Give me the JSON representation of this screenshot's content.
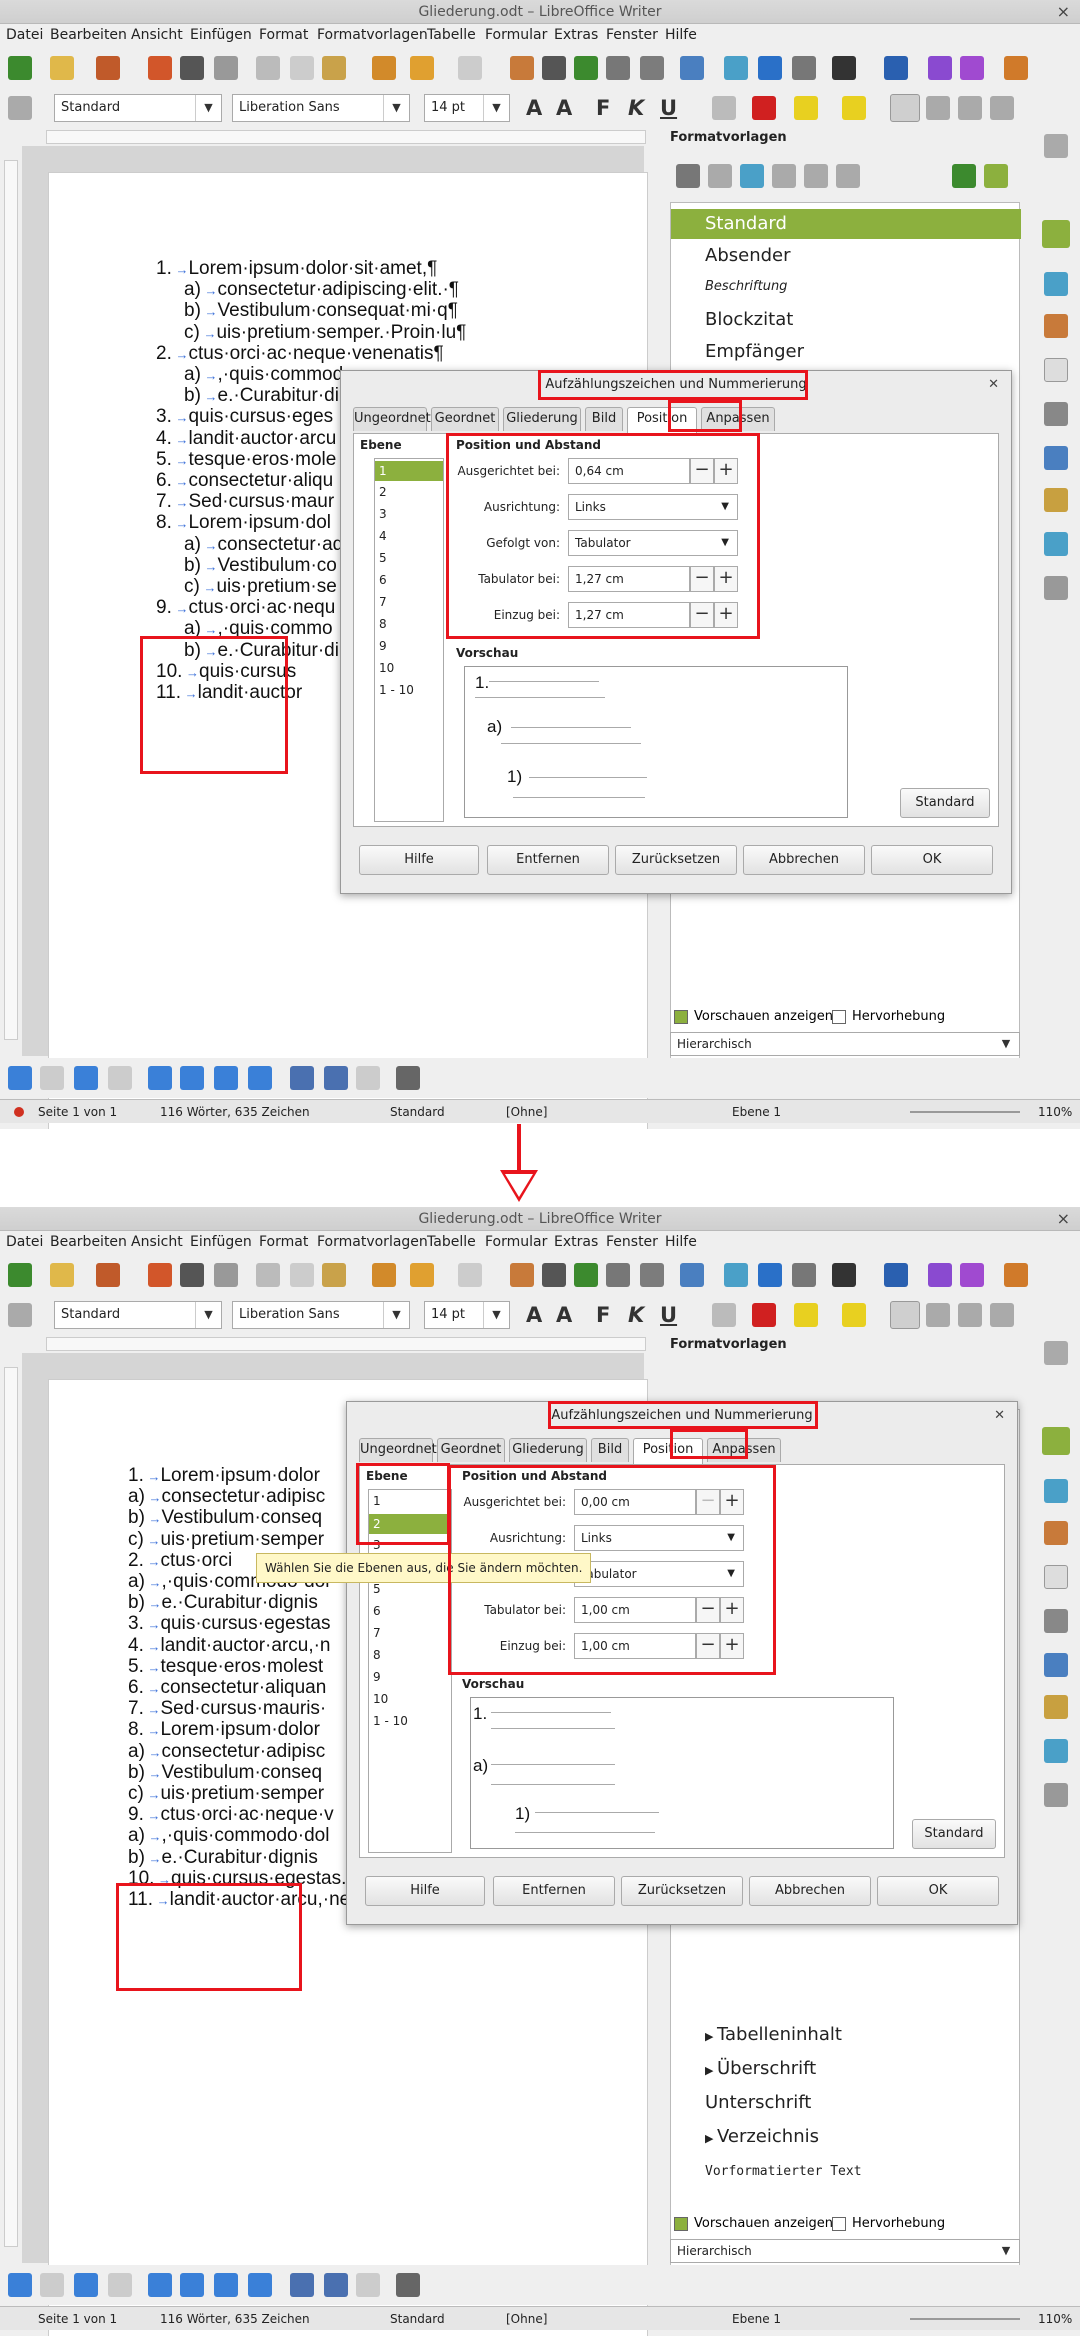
{
  "app": {
    "window_title": "Gliederung.odt – LibreOffice Writer",
    "close_glyph": "×",
    "menu": [
      "Datei",
      "Bearbeiten",
      "Ansicht",
      "Einfügen",
      "Format",
      "Formatvorlagen",
      "Tabelle",
      "Formular",
      "Extras",
      "Fenster",
      "Hilfe"
    ]
  },
  "toolbar": {
    "paragraph_style": "Standard",
    "font_name": "Liberation Sans",
    "font_size": "14 pt",
    "format_glyphs": [
      "F",
      "K",
      "U"
    ]
  },
  "sidebar": {
    "title": "Formatvorlagen",
    "styles_before": [
      "Standard",
      "Absender",
      "Beschriftung",
      "Blockzitat",
      "Empfänger"
    ],
    "styles_after": [
      "Tabelleninhalt",
      "Überschrift",
      "Unterschrift",
      "Verzeichnis",
      "Vorformatierter Text"
    ],
    "show_previews": "Vorschauen anzeigen",
    "highlight": "Hervorhebung",
    "view_mode": "Hierarchisch"
  },
  "status": {
    "page": "Seite 1 von 1",
    "words": "116 Wörter, 635 Zeichen",
    "page_style": "Standard",
    "lang": "[Ohne]",
    "level": "Ebene 1",
    "zoom": "110%"
  },
  "doc_before": {
    "lines": [
      {
        "num": "1.",
        "text": "Lorem·ipsum·dolor·sit·amet,¶"
      },
      {
        "num": "a)",
        "text": "consectetur·adipiscing·elit.·¶"
      },
      {
        "num": "b)",
        "text": "Vestibulum·consequat·mi·q¶"
      },
      {
        "num": "c)",
        "text": "uis·pretium·semper.·Proin·lu¶"
      },
      {
        "num": "2.",
        "text": "ctus·orci·ac·neque·venenatis¶"
      },
      {
        "num": "a)",
        "text": ",·quis·commod"
      },
      {
        "num": "b)",
        "text": "e.·Curabitur·di"
      },
      {
        "num": "3.",
        "text": "quis·cursus·eges"
      },
      {
        "num": "4.",
        "text": "landit·auctor·arcu"
      },
      {
        "num": "5.",
        "text": "tesque·eros·mole"
      },
      {
        "num": "6.",
        "text": "consectetur·aliqu"
      },
      {
        "num": "7.",
        "text": "Sed·cursus·maur"
      },
      {
        "num": "8.",
        "text": "Lorem·ipsum·dol"
      },
      {
        "num": "a)",
        "text": "consectetur·ad"
      },
      {
        "num": "b)",
        "text": "Vestibulum·co"
      },
      {
        "num": "c)",
        "text": "uis·pretium·se"
      },
      {
        "num": "9.",
        "text": "ctus·orci·ac·nequ"
      },
      {
        "num": "a)",
        "text": ",·quis·commo"
      },
      {
        "num": "b)",
        "text": "e.·Curabitur·di"
      },
      {
        "num": "10.",
        "text": "quis·cursus"
      },
      {
        "num": "11.",
        "text": "landit·auctor"
      }
    ]
  },
  "doc_after": {
    "lines": [
      {
        "num": "1.",
        "text": "Lorem·ipsum·dolor"
      },
      {
        "num": "a)",
        "text": "consectetur·adipisc"
      },
      {
        "num": "b)",
        "text": "Vestibulum·conseq"
      },
      {
        "num": "c)",
        "text": "uis·pretium·semper"
      },
      {
        "num": "2.",
        "text": "ctus·orci"
      },
      {
        "num": "a)",
        "text": ",·quis·commodo·dol"
      },
      {
        "num": "b)",
        "text": "e.·Curabitur·dignis"
      },
      {
        "num": "3.",
        "text": "quis·cursus·egestas"
      },
      {
        "num": "4.",
        "text": "landit·auctor·arcu,·n"
      },
      {
        "num": "5.",
        "text": "tesque·eros·molest"
      },
      {
        "num": "6.",
        "text": "consectetur·aliquan"
      },
      {
        "num": "7.",
        "text": "Sed·cursus·mauris·"
      },
      {
        "num": "8.",
        "text": "Lorem·ipsum·dolor"
      },
      {
        "num": "a)",
        "text": "consectetur·adipisc"
      },
      {
        "num": "b)",
        "text": "Vestibulum·conseq"
      },
      {
        "num": "c)",
        "text": "uis·pretium·semper"
      },
      {
        "num": "9.",
        "text": "ctus·orci·ac·neque·v"
      },
      {
        "num": "a)",
        "text": ",·quis·commodo·dol"
      },
      {
        "num": "b)",
        "text": "e.·Curabitur·dignis"
      },
      {
        "num": "10.",
        "text": "quis·cursus·egestas.·Donec·b"
      },
      {
        "num": "11.",
        "text": "landit·auctor·arcu,·nec·pellen¶"
      }
    ]
  },
  "dialog": {
    "title": "Aufzählungszeichen und Nummerierung",
    "tabs": [
      "Ungeordnet",
      "Geordnet",
      "Gliederung",
      "Bild",
      "Position",
      "Anpassen"
    ],
    "active_tab": "Position",
    "level_label": "Ebene",
    "levels": [
      "1",
      "2",
      "3",
      "4",
      "5",
      "6",
      "7",
      "8",
      "9",
      "10",
      "1 - 10"
    ],
    "section_title": "Position und Abstand",
    "label_aligned": "Ausgerichtet bei:",
    "label_alignment": "Ausrichtung:",
    "label_followed": "Gefolgt von:",
    "label_tab": "Tabulator bei:",
    "label_indent": "Einzug bei:",
    "preview_title": "Vorschau",
    "preview_labels": [
      "1.",
      "a)",
      "1)"
    ],
    "btn_standard": "Standard",
    "buttons": [
      "Hilfe",
      "Entfernen",
      "Zurücksetzen",
      "Abbrechen",
      "OK"
    ],
    "before": {
      "selected_level": "1",
      "aligned": "0,64 cm",
      "alignment": "Links",
      "followed": "Tabulator",
      "tab": "1,27 cm",
      "indent": "1,27 cm"
    },
    "after": {
      "selected_level": "2",
      "aligned": "0,00 cm",
      "alignment": "Links",
      "followed": "Tabulator",
      "tab": "1,00 cm",
      "indent": "1,00 cm"
    },
    "tooltip": "Wählen Sie die Ebenen aus, die Sie ändern möchten."
  },
  "colors": {
    "accent": "#8cb03e",
    "annotation": "#e8141c"
  }
}
